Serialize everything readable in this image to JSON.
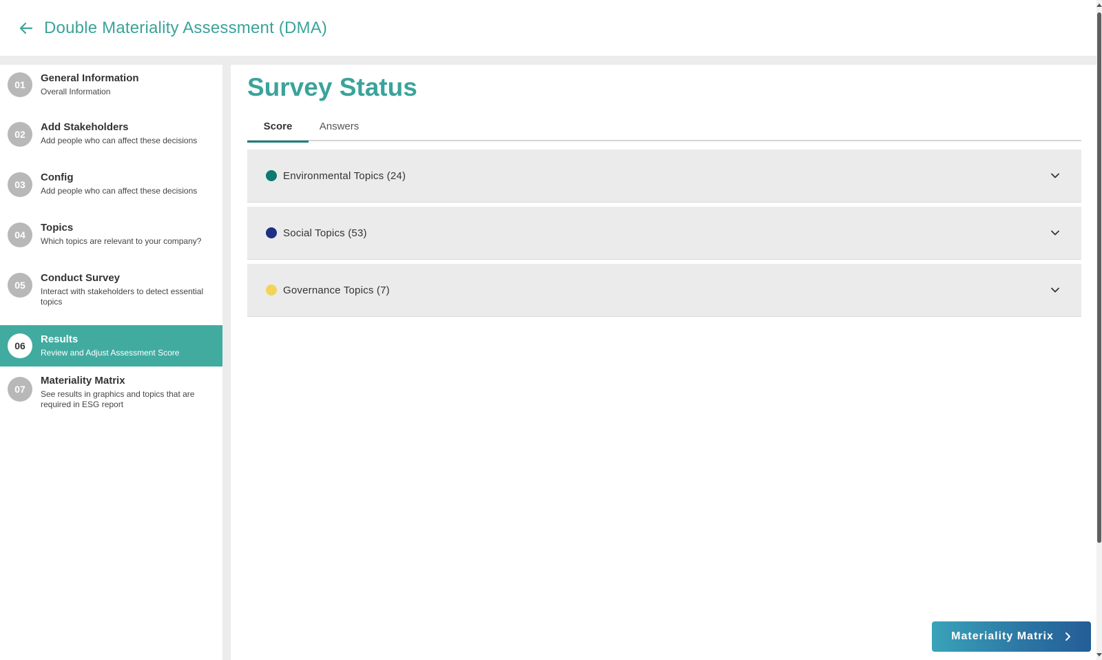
{
  "header": {
    "title": "Double Materiality Assessment (DMA)",
    "back_icon": "arrow-left-icon",
    "accent": "#3aa39a"
  },
  "sidebar": {
    "steps": [
      {
        "num": "01",
        "title": "General Information",
        "subtitle": "Overall Information"
      },
      {
        "num": "02",
        "title": "Add Stakeholders",
        "subtitle": "Add people who can affect these decisions"
      },
      {
        "num": "03",
        "title": "Config",
        "subtitle": "Add people who can affect these decisions"
      },
      {
        "num": "04",
        "title": "Topics",
        "subtitle": "Which topics are relevant to your company?"
      },
      {
        "num": "05",
        "title": "Conduct Survey",
        "subtitle": "Interact with stakeholders to detect essential topics"
      },
      {
        "num": "06",
        "title": "Results",
        "subtitle": "Review and Adjust Assessment Score",
        "active": true
      },
      {
        "num": "07",
        "title": "Materiality Matrix",
        "subtitle": "See results in graphics and topics that are required in ESG report"
      }
    ],
    "active_color": "#41aba0"
  },
  "main": {
    "title": "Survey Status",
    "tabs": [
      {
        "label": "Score",
        "active": true
      },
      {
        "label": "Answers",
        "active": false
      }
    ],
    "sections": [
      {
        "label": "Environmental Topics (24)",
        "color": "#0c7a6d",
        "icon": "chevron-down-icon"
      },
      {
        "label": "Social Topics (53)",
        "color": "#1f2f86",
        "icon": "chevron-down-icon"
      },
      {
        "label": "Governance Topics (7)",
        "color": "#f3d35a",
        "icon": "chevron-down-icon"
      }
    ]
  },
  "footer": {
    "next_button": "Materiality Matrix",
    "next_icon": "chevron-right-icon"
  }
}
